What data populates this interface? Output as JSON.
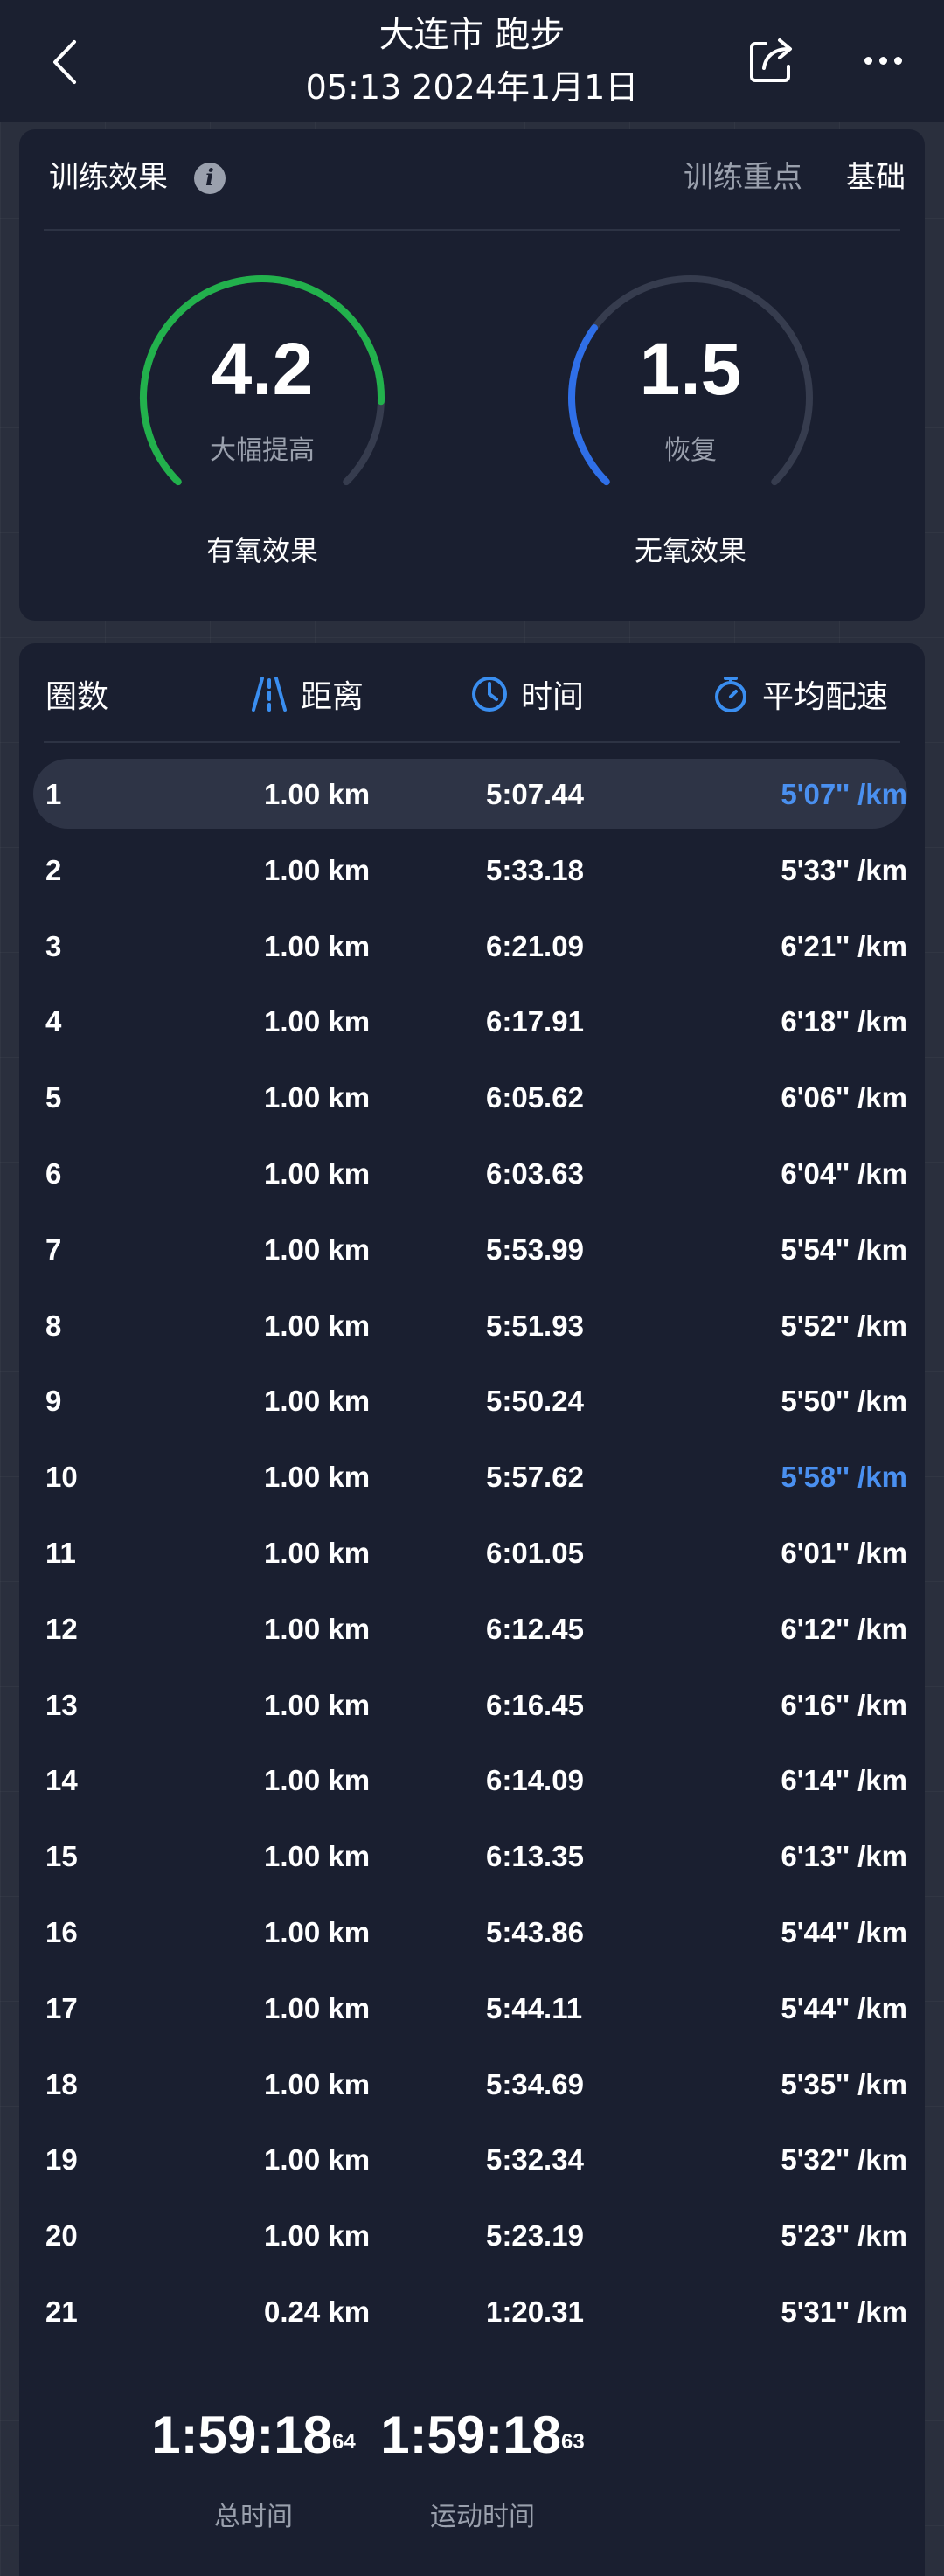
{
  "header": {
    "title": "大连市 跑步",
    "subtitle": "05:13 2024年1月1日"
  },
  "training": {
    "title": "训练效果",
    "focus_label": "训练重点",
    "focus_value": "基础",
    "aerobic": {
      "value": "4.2",
      "desc": "大幅提高",
      "name": "有氧效果",
      "fraction": 0.84,
      "color": "#22b14c"
    },
    "anaerobic": {
      "value": "1.5",
      "desc": "恢复",
      "name": "无氧效果",
      "fraction": 0.3,
      "color": "#2f6fe8"
    }
  },
  "laps": {
    "headers": {
      "lap": "圈数",
      "distance": "距离",
      "time": "时间",
      "pace": "平均配速"
    },
    "rows": [
      {
        "lap": "1",
        "distance": "1.00 km",
        "time": "5:07.44",
        "pace": "5'07'' /km"
      },
      {
        "lap": "2",
        "distance": "1.00 km",
        "time": "5:33.18",
        "pace": "5'33'' /km"
      },
      {
        "lap": "3",
        "distance": "1.00 km",
        "time": "6:21.09",
        "pace": "6'21'' /km"
      },
      {
        "lap": "4",
        "distance": "1.00 km",
        "time": "6:17.91",
        "pace": "6'18'' /km"
      },
      {
        "lap": "5",
        "distance": "1.00 km",
        "time": "6:05.62",
        "pace": "6'06'' /km"
      },
      {
        "lap": "6",
        "distance": "1.00 km",
        "time": "6:03.63",
        "pace": "6'04'' /km"
      },
      {
        "lap": "7",
        "distance": "1.00 km",
        "time": "5:53.99",
        "pace": "5'54'' /km"
      },
      {
        "lap": "8",
        "distance": "1.00 km",
        "time": "5:51.93",
        "pace": "5'52'' /km"
      },
      {
        "lap": "9",
        "distance": "1.00 km",
        "time": "5:50.24",
        "pace": "5'50'' /km"
      },
      {
        "lap": "10",
        "distance": "1.00 km",
        "time": "5:57.62",
        "pace": "5'58'' /km"
      },
      {
        "lap": "11",
        "distance": "1.00 km",
        "time": "6:01.05",
        "pace": "6'01'' /km"
      },
      {
        "lap": "12",
        "distance": "1.00 km",
        "time": "6:12.45",
        "pace": "6'12'' /km"
      },
      {
        "lap": "13",
        "distance": "1.00 km",
        "time": "6:16.45",
        "pace": "6'16'' /km"
      },
      {
        "lap": "14",
        "distance": "1.00 km",
        "time": "6:14.09",
        "pace": "6'14'' /km"
      },
      {
        "lap": "15",
        "distance": "1.00 km",
        "time": "6:13.35",
        "pace": "6'13'' /km"
      },
      {
        "lap": "16",
        "distance": "1.00 km",
        "time": "5:43.86",
        "pace": "5'44'' /km"
      },
      {
        "lap": "17",
        "distance": "1.00 km",
        "time": "5:44.11",
        "pace": "5'44'' /km"
      },
      {
        "lap": "18",
        "distance": "1.00 km",
        "time": "5:34.69",
        "pace": "5'35'' /km"
      },
      {
        "lap": "19",
        "distance": "1.00 km",
        "time": "5:32.34",
        "pace": "5'32'' /km"
      },
      {
        "lap": "20",
        "distance": "1.00 km",
        "time": "5:23.19",
        "pace": "5'23'' /km"
      },
      {
        "lap": "21",
        "distance": "0.24 km",
        "time": "1:20.31",
        "pace": "5'31'' /km"
      }
    ],
    "highlight_color": "#4a90f0"
  },
  "totals": {
    "total_time": "1:59:18",
    "total_time_frac": "64",
    "total_label": "总时间",
    "moving_time": "1:59:18",
    "moving_time_frac": "63",
    "moving_label": "运动时间"
  },
  "icons": [
    "back-icon",
    "share-icon",
    "more-icon",
    "info-icon",
    "distance-icon",
    "clock-icon",
    "stopwatch-icon"
  ]
}
